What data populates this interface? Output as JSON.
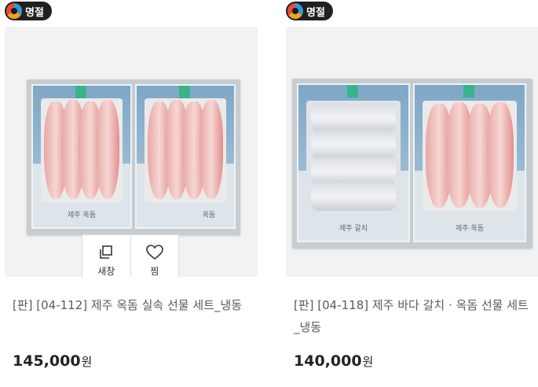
{
  "products": [
    {
      "badge": "명절",
      "title": "[판] [04-112] 제주 옥돔 실속 선물 세트_냉동",
      "price": "145,000",
      "currency": "원",
      "box_labels": [
        "제주 옥돔",
        "옥돔"
      ],
      "hover_actions": [
        {
          "label": "새창",
          "icon": "new-window-icon"
        },
        {
          "label": "찜",
          "icon": "heart-icon"
        }
      ]
    },
    {
      "badge": "명절",
      "title": "[판] [04-118] 제주 바다 갈치 · 옥돔 선물 세트_냉동",
      "price": "140,000",
      "currency": "원",
      "box_labels": [
        "제주 갈치",
        "제주 옥돔"
      ]
    }
  ],
  "colors": {
    "badge_bg": "#202020",
    "box_blue": "#7ea7c6",
    "stripe_green": "#3bb38a",
    "price_text": "#222222",
    "title_text": "#5b5b5b"
  }
}
